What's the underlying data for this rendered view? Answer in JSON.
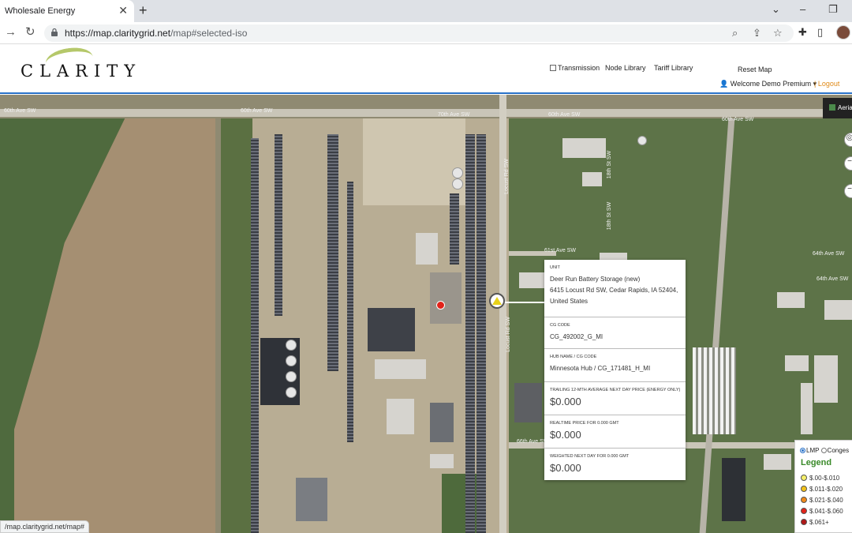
{
  "browser": {
    "tab_title": "Wholesale Energy",
    "tab_close": "✕",
    "new_tab": "+",
    "url_host": "https://map.claritygrid.net",
    "url_path": "/map#selected-iso",
    "status_url": "/map.claritygrid.net/map#"
  },
  "header": {
    "logo_text": "CLARITY",
    "transmission_label": "Transmission",
    "node_library": "Node Library",
    "tariff_library": "Tariff Library",
    "reset_map": "Reset Map",
    "welcome": "Welcome Demo Premium",
    "logout": "| Logout"
  },
  "map": {
    "aerial_label": "Aeria",
    "road_labels": [
      "60th Ave SW",
      "60th Ave SW",
      "70th Ave SW",
      "60th Ave SW",
      "60th Ave SW",
      "64th Ave SW",
      "66th Ave SW",
      "Locust Rd SW",
      "Locust Rd SW",
      "18th St SW",
      "18th St SW",
      "61st Ave SW",
      "64th Ave SW"
    ]
  },
  "popup": {
    "unit_label": "UNIT",
    "unit_name": "Deer Run Battery Storage (new)",
    "unit_address": "6415 Locust Rd SW, Cedar Rapids, IA 52404, United States",
    "cg_code_label": "CG CODE",
    "cg_code": "CG_492002_G_MI",
    "hub_label": "HUB Name / CG CODE",
    "hub_value": "Minnesota Hub / CG_171481_H_MI",
    "trailing_label": "TRAILING 12-mth AVERAGE NEXT DAY PRICE (Energy only)",
    "trailing_value": "$0.000",
    "realtime_label": "REALTIME PRICE FOR 0.000 GMT",
    "realtime_value": "$0.000",
    "weighted_label": "WEIGHTED NEXT DAY FOR 0.000 GMT",
    "weighted_value": "$0.000"
  },
  "legend": {
    "mode_lmp": "LMP",
    "mode_congestion": "Conges",
    "title": "Legend",
    "items": [
      {
        "label": "$.00-$.010",
        "color": "#f6f06a"
      },
      {
        "label": "$.011-$.020",
        "color": "#f2c21a"
      },
      {
        "label": "$.021-$.040",
        "color": "#f08a1a"
      },
      {
        "label": "$.041-$.060",
        "color": "#e2231a"
      },
      {
        "label": "$.061+",
        "color": "#b01818"
      }
    ]
  }
}
